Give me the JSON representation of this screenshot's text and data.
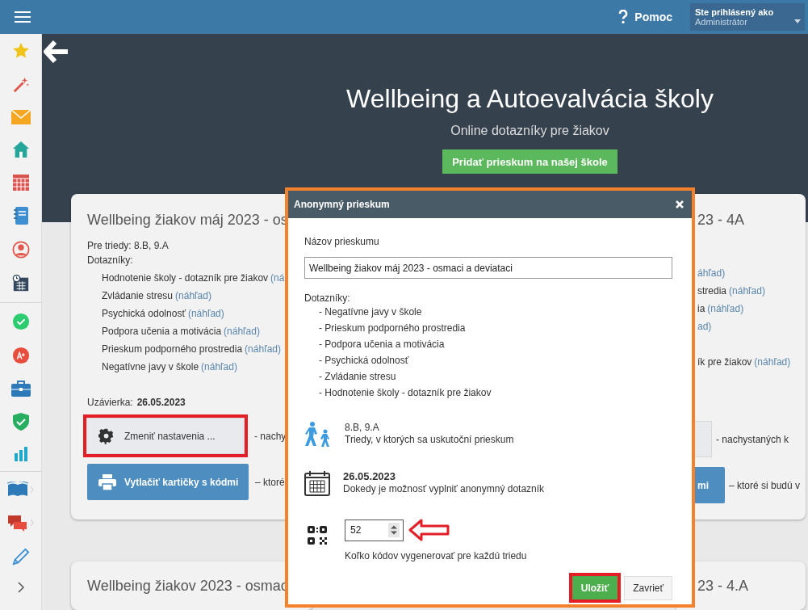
{
  "top_bar": {
    "help_label": "Pomoc",
    "user": {
      "caption": "Ste prihlásený ako",
      "role": "Administrátor"
    }
  },
  "hero": {
    "title": "Wellbeing a Autoevalvácia školy",
    "subtitle": "Online dotazníky pre žiakov",
    "add_button": "Pridať prieskum na našej škole"
  },
  "left_card": {
    "title": "Wellbeing žiakov máj 2023 - os",
    "classes": "Pre triedy: 8.B, 9.A",
    "questionnaires_label": "Dotazníky:",
    "questionnaires": [
      {
        "name": "Hodnotenie školy - dotazník pre žiakov",
        "preview": "(ná"
      },
      {
        "name": "Zvládanie stresu",
        "preview": "(náhľad)"
      },
      {
        "name": "Psychická odolnosť",
        "preview": "(náhľad)"
      },
      {
        "name": "Podpora učenia a motivácia",
        "preview": "(náhľad)"
      },
      {
        "name": "Prieskum podporného prostredia",
        "preview": "(náhľad)"
      },
      {
        "name": "Negatívne javy v škole",
        "preview": "(náhľad)"
      }
    ],
    "deadline_label": "Uzávierka:",
    "deadline": "26.05.2023",
    "settings_button": {
      "label": "Zmeniť nastavenia ...",
      "highlighted": true
    },
    "settings_note": "- nachy",
    "print_button": "Vytlačiť kartičky s kódmi",
    "print_note": "– ktoré"
  },
  "right_card": {
    "title": "23 - 4A",
    "questionnaires": [
      {
        "preview": "áhľad)"
      },
      {
        "name": "stredia",
        "preview": "(náhľad)"
      },
      {
        "name": "ia",
        "preview": "(náhľad)"
      },
      {
        "preview": "ad)"
      },
      {
        "name": "ík pre žiakov",
        "preview": "(náhľad)"
      }
    ],
    "settings_note": "- nachystaných k",
    "print_button": "mi",
    "print_note": "– ktoré si budú v"
  },
  "bottom_cards": [
    {
      "title": "Wellbeing žiakov 2023 - osmac"
    },
    {
      "title": "23 - 4.A"
    }
  ],
  "modal": {
    "title": "Anonymný prieskum",
    "name_label": "Názov prieskumu",
    "name_value": "Wellbeing žiakov máj 2023 - osmaci a deviataci",
    "questionnaires_label": "Dotazníky:",
    "questionnaires": [
      "- Negatívne javy v škole",
      "- Prieskum podporného prostredia",
      "- Podpora učenia a motivácia",
      "- Psychická odolnosť",
      "- Zvládanie stresu",
      "- Hodnotenie školy - dotazník pre žiakov"
    ],
    "classes": {
      "value": "8.B, 9.A",
      "caption": "Triedy, v ktorých sa uskutoční prieskum"
    },
    "deadline": {
      "value": "26.05.2023",
      "caption": "Dokedy je možnosť vyplniť anonymný dotazník"
    },
    "codes": {
      "value": "52",
      "caption": "Koľko kódov vygenerovať pre každú triedu",
      "annotated": true
    },
    "save_button": {
      "label": "Uložiť",
      "highlighted": true
    },
    "close_button": "Zavrieť"
  }
}
